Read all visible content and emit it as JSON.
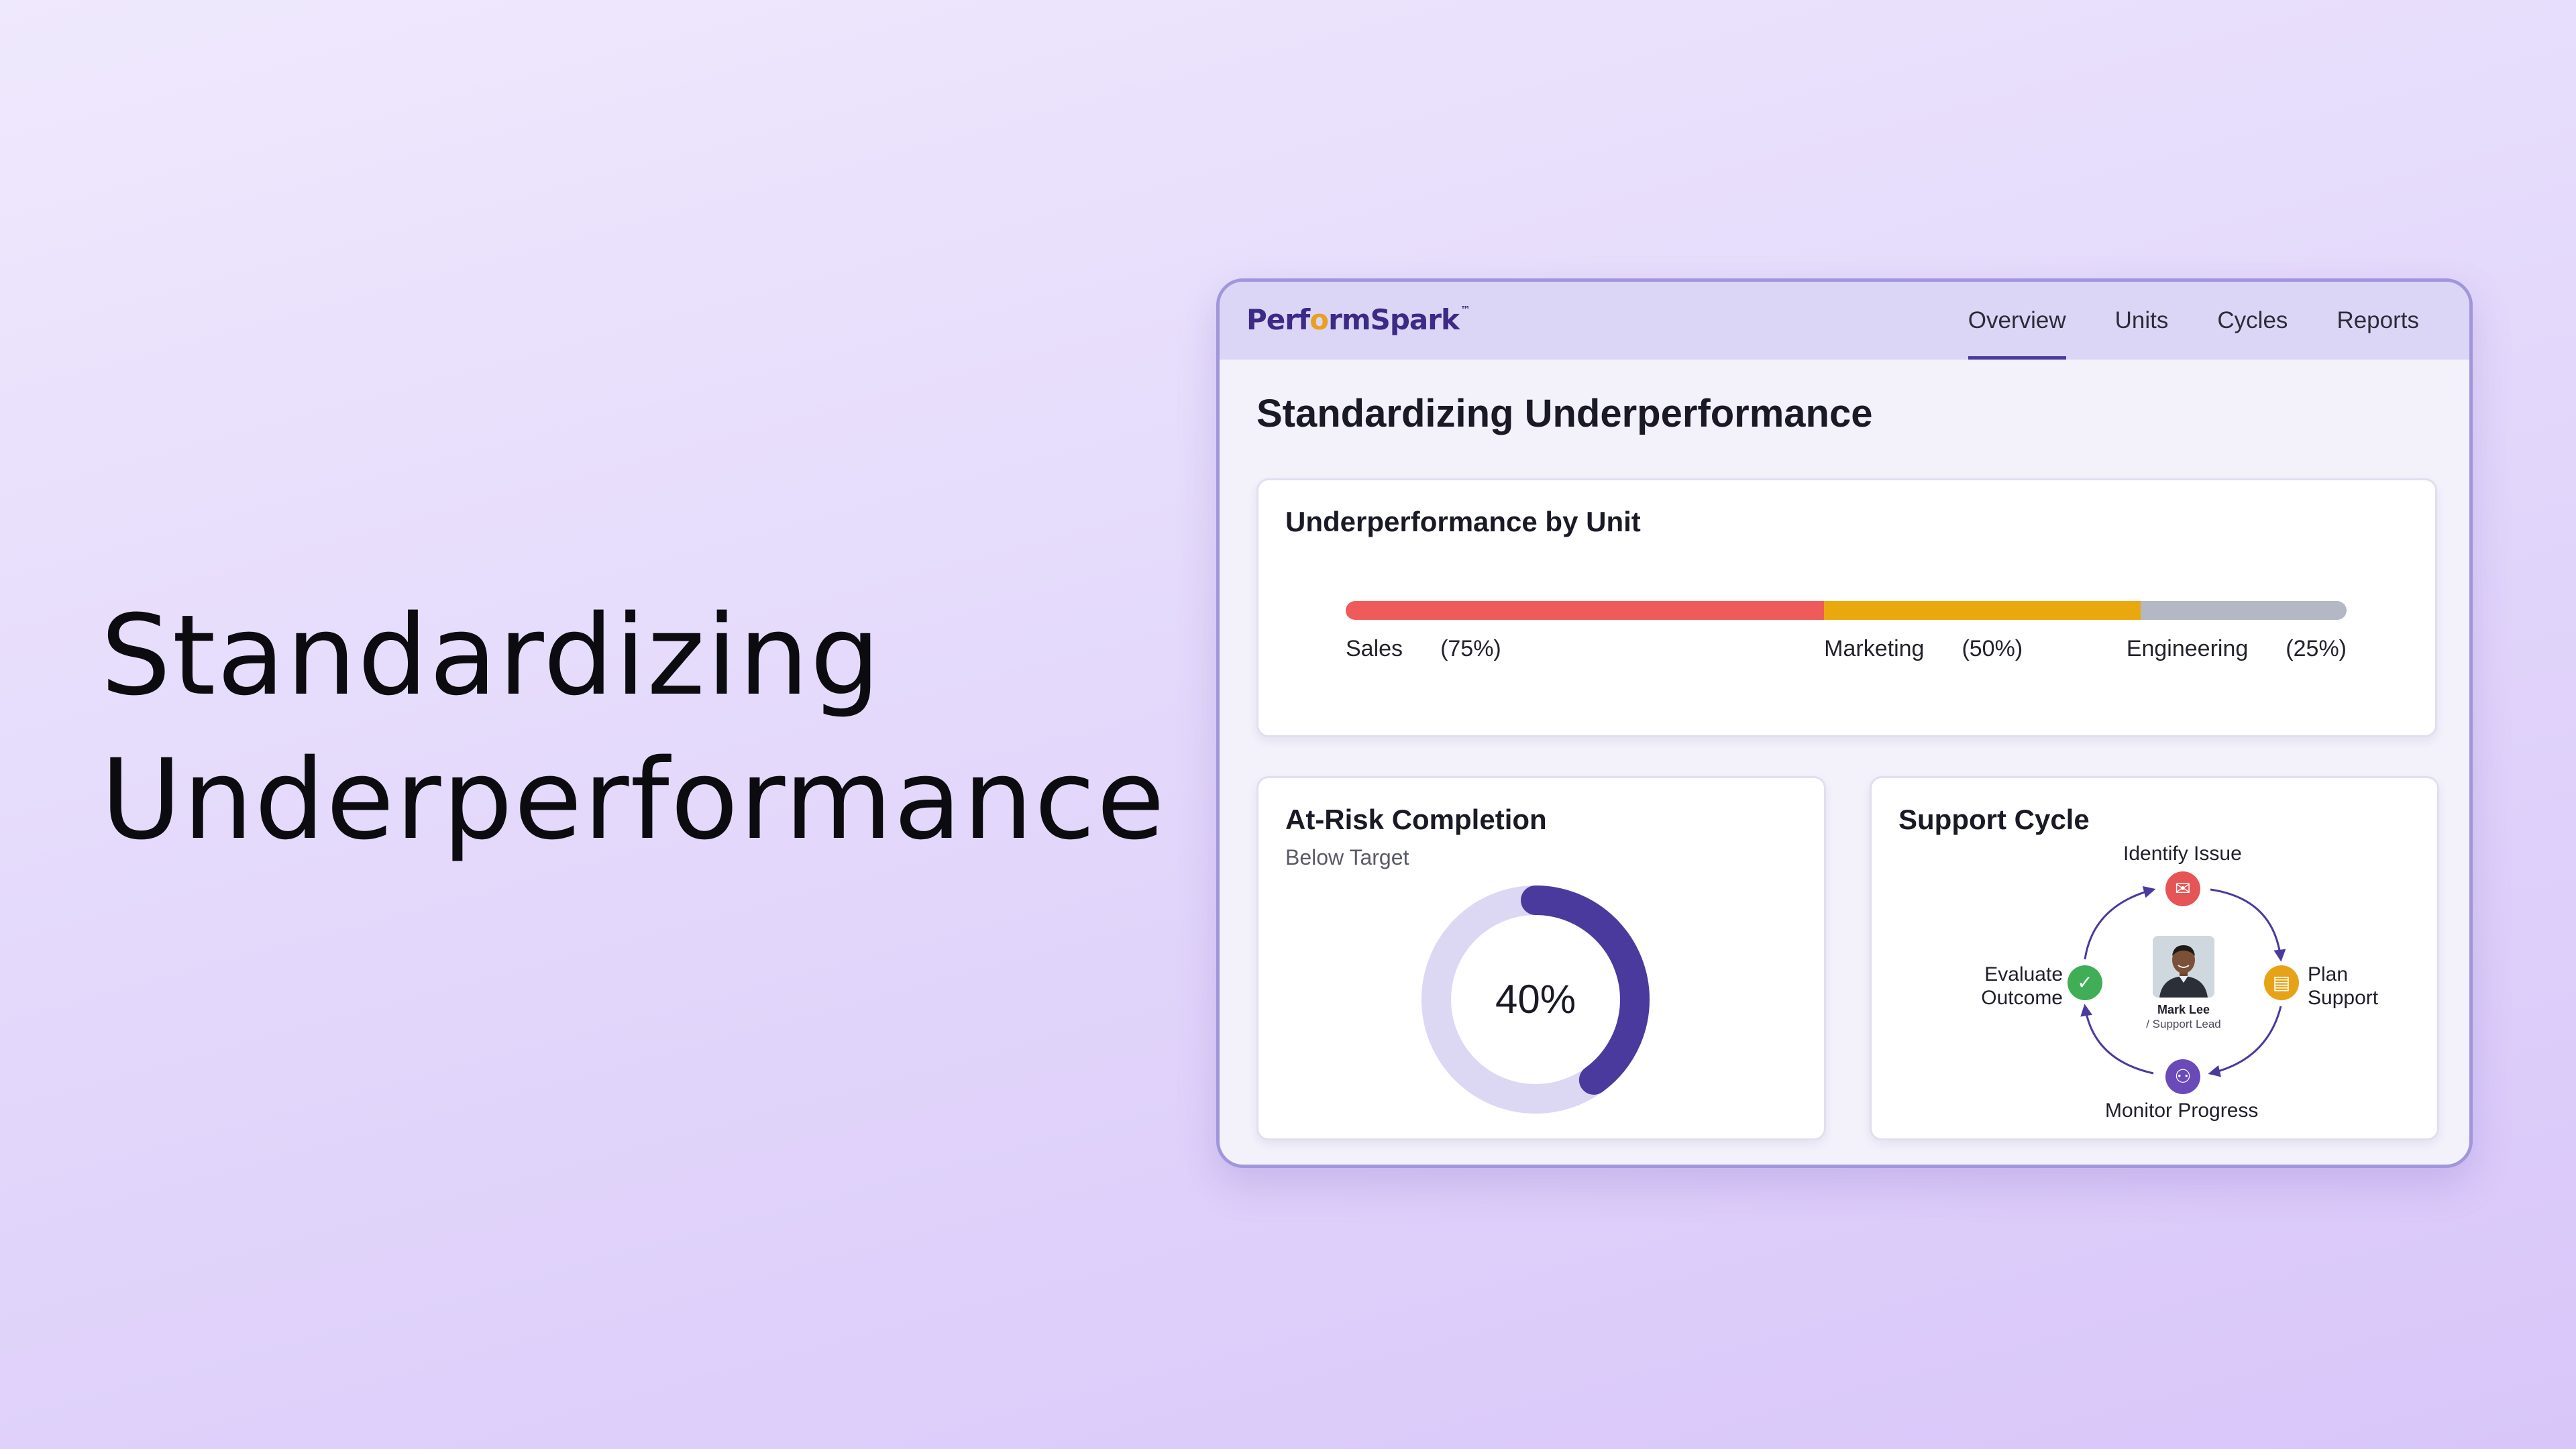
{
  "hero": {
    "line1": "Standardizing",
    "line2": "Underperformance"
  },
  "app": {
    "logo_prefix": "Perf",
    "logo_o": "o",
    "logo_suffix": "rmSpark",
    "logo_tm": "™",
    "nav": [
      "Overview",
      "Units",
      "Cycles",
      "Reports"
    ],
    "active_nav": "Overview",
    "page_title": "Standardizing Underperformance"
  },
  "unit_card": {
    "title": "Underperformance by Unit",
    "segments": [
      {
        "name": "Sales",
        "value_label": "(75%)",
        "color": "#ef5b5b",
        "share": 0.478
      },
      {
        "name": "Marketing",
        "value_label": "(50%)",
        "color": "#eaa80f",
        "share": 0.316
      },
      {
        "name": "Engineering",
        "value_label": "(25%)",
        "color": "#b4b8c5",
        "share": 0.206
      }
    ]
  },
  "risk_card": {
    "title": "At-Risk Completion",
    "subtitle": "Below Target",
    "value_label": "40%",
    "progress": 0.4,
    "track_color": "#dcd7f2",
    "fill_color": "#4a3a9e"
  },
  "cycle_card": {
    "title": "Support Cycle",
    "steps": {
      "identify": {
        "label": "Identify Issue",
        "icon": "chat-icon",
        "color": "#e65555"
      },
      "plan": {
        "label_line1": "Plan",
        "label_line2": "Support",
        "icon": "clipboard-icon",
        "color": "#e6a317"
      },
      "monitor": {
        "label": "Monitor Progress",
        "icon": "users-icon",
        "color": "#6a4ab8"
      },
      "evaluate": {
        "label_line1": "Evaluate",
        "label_line2": "Outcome",
        "icon": "check-circle-icon",
        "color": "#3fae57"
      }
    },
    "person": {
      "name": "Mark Lee",
      "role": "/ Support Lead"
    }
  }
}
